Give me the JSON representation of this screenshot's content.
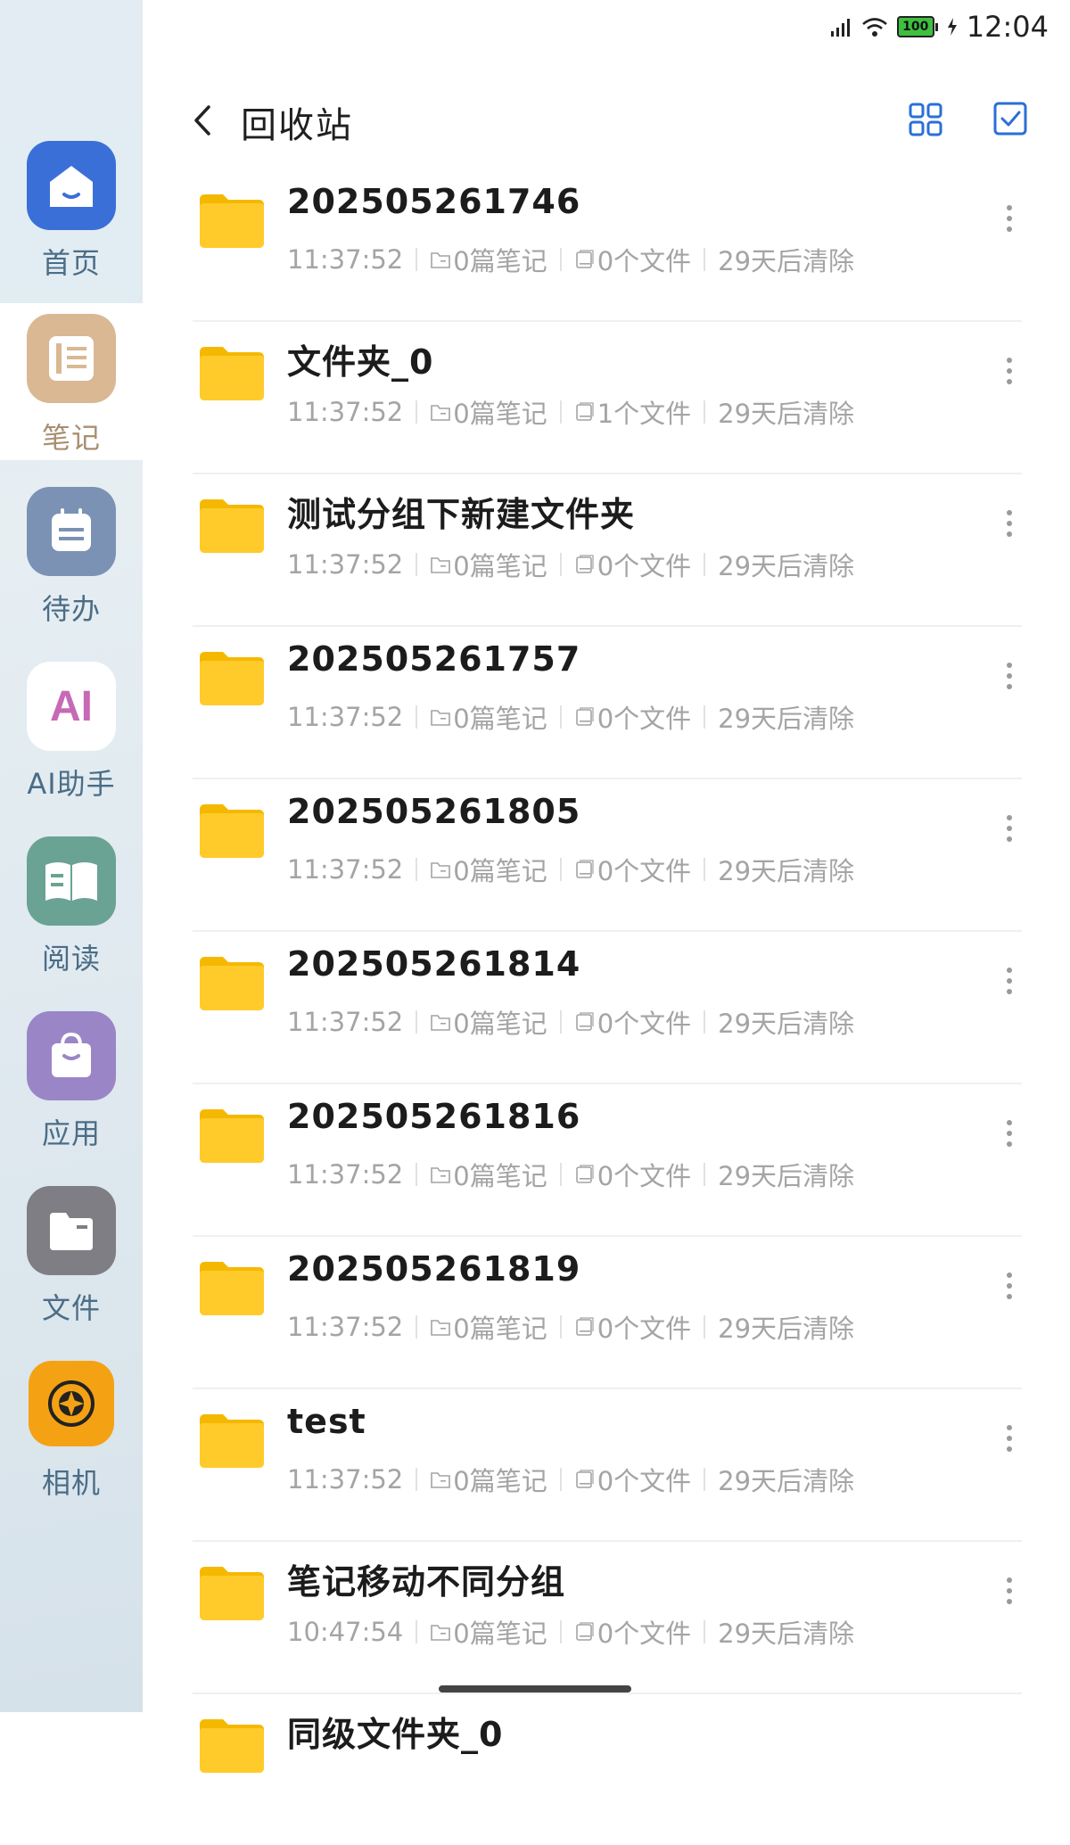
{
  "status": {
    "time": "12:04",
    "battery": "100"
  },
  "header": {
    "title": "回收站"
  },
  "sidebar": {
    "items": [
      {
        "label": "首页"
      },
      {
        "label": "笔记"
      },
      {
        "label": "待办"
      },
      {
        "label": "AI助手",
        "icon_text": "AI"
      },
      {
        "label": "阅读"
      },
      {
        "label": "应用"
      },
      {
        "label": "文件"
      },
      {
        "label": "相机"
      }
    ]
  },
  "items": [
    {
      "title": "202505261746",
      "time": "11:37:52",
      "notes": "0篇笔记",
      "files": "0个文件",
      "clear": "29天后清除"
    },
    {
      "title": "文件夹_0",
      "time": "11:37:52",
      "notes": "0篇笔记",
      "files": "1个文件",
      "clear": "29天后清除"
    },
    {
      "title": "测试分组下新建文件夹",
      "time": "11:37:52",
      "notes": "0篇笔记",
      "files": "0个文件",
      "clear": "29天后清除"
    },
    {
      "title": "202505261757",
      "time": "11:37:52",
      "notes": "0篇笔记",
      "files": "0个文件",
      "clear": "29天后清除"
    },
    {
      "title": "202505261805",
      "time": "11:37:52",
      "notes": "0篇笔记",
      "files": "0个文件",
      "clear": "29天后清除"
    },
    {
      "title": "202505261814",
      "time": "11:37:52",
      "notes": "0篇笔记",
      "files": "0个文件",
      "clear": "29天后清除"
    },
    {
      "title": "202505261816",
      "time": "11:37:52",
      "notes": "0篇笔记",
      "files": "0个文件",
      "clear": "29天后清除"
    },
    {
      "title": "202505261819",
      "time": "11:37:52",
      "notes": "0篇笔记",
      "files": "0个文件",
      "clear": "29天后清除"
    },
    {
      "title": "test",
      "time": "11:37:52",
      "notes": "0篇笔记",
      "files": "0个文件",
      "clear": "29天后清除"
    },
    {
      "title": "笔记移动不同分组",
      "time": "10:47:54",
      "notes": "0篇笔记",
      "files": "0个文件",
      "clear": "29天后清除"
    },
    {
      "title": "同级文件夹_0",
      "time": "",
      "notes": "",
      "files": "",
      "clear": ""
    }
  ],
  "colors": {
    "accent": "#2a6fd6",
    "folder": "#ffcb2b",
    "meta_text": "#a4a4a4"
  }
}
